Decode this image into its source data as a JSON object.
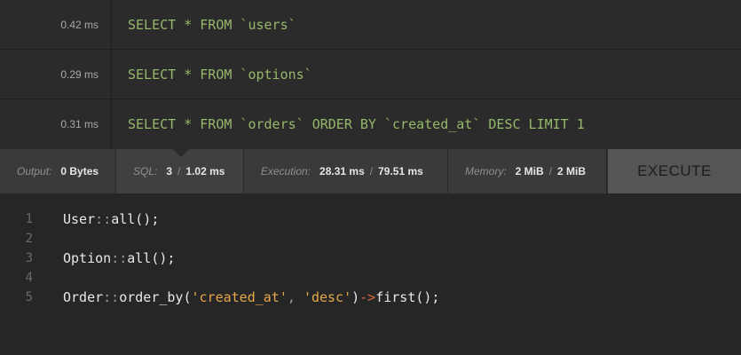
{
  "queries": [
    {
      "time": "0.42 ms",
      "sql": "SELECT * FROM `users`"
    },
    {
      "time": "0.29 ms",
      "sql": "SELECT * FROM `options`"
    },
    {
      "time": "0.31 ms",
      "sql": "SELECT * FROM `orders` ORDER BY `created_at` DESC LIMIT 1"
    }
  ],
  "status": {
    "output": {
      "label": "Output:",
      "value": "0 Bytes"
    },
    "sql": {
      "label": "SQL:",
      "count": "3",
      "sep": "/",
      "time": "1.02 ms"
    },
    "execution": {
      "label": "Execution:",
      "value1": "28.31 ms",
      "sep": "/",
      "value2": "79.51 ms"
    },
    "memory": {
      "label": "Memory:",
      "value1": "2 MiB",
      "sep": "/",
      "value2": "2 MiB"
    },
    "execute_label": "EXECUTE"
  },
  "editor": {
    "lines": [
      {
        "number": "1",
        "tokens": [
          {
            "t": "User",
            "c": "plain"
          },
          {
            "t": "::",
            "c": "punct"
          },
          {
            "t": "all",
            "c": "plain"
          },
          {
            "t": "();",
            "c": "plain"
          }
        ]
      },
      {
        "number": "2",
        "tokens": []
      },
      {
        "number": "3",
        "tokens": [
          {
            "t": "Option",
            "c": "plain"
          },
          {
            "t": "::",
            "c": "punct"
          },
          {
            "t": "all",
            "c": "plain"
          },
          {
            "t": "();",
            "c": "plain"
          }
        ]
      },
      {
        "number": "4",
        "tokens": []
      },
      {
        "number": "5",
        "tokens": [
          {
            "t": "Order",
            "c": "plain"
          },
          {
            "t": "::",
            "c": "punct"
          },
          {
            "t": "order_by(",
            "c": "plain"
          },
          {
            "t": "'created_at'",
            "c": "string"
          },
          {
            "t": ", ",
            "c": "punct"
          },
          {
            "t": "'desc'",
            "c": "string"
          },
          {
            "t": ")",
            "c": "plain"
          },
          {
            "t": "->",
            "c": "arrow"
          },
          {
            "t": "first();",
            "c": "plain"
          }
        ]
      }
    ]
  }
}
